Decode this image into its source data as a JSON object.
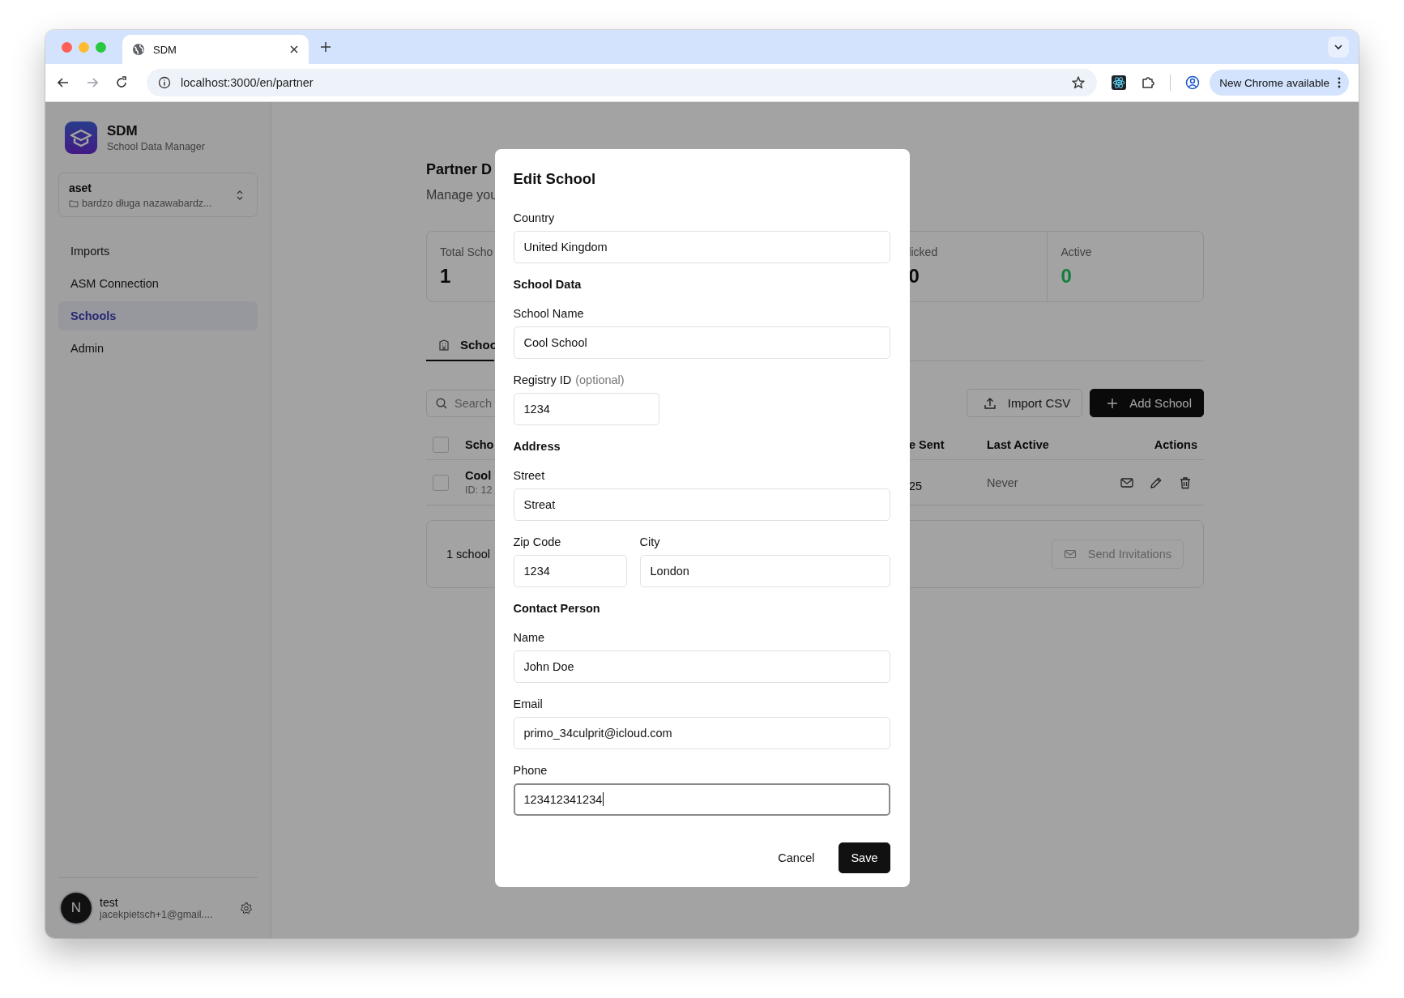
{
  "browser": {
    "tab_title": "SDM",
    "url": "localhost:3000/en/partner",
    "update_button": "New Chrome available"
  },
  "sidebar": {
    "app_name": "SDM",
    "app_subtitle": "School Data Manager",
    "org": {
      "name": "aset",
      "folder": "bardzo długa nazawabardz..."
    },
    "nav": [
      {
        "label": "Imports",
        "selected": false
      },
      {
        "label": "ASM Connection",
        "selected": false
      },
      {
        "label": "Schools",
        "selected": true
      },
      {
        "label": "Admin",
        "selected": false
      }
    ],
    "user": {
      "avatar_initial": "N",
      "name": "test",
      "email": "jacekpietsch+1@gmail...."
    }
  },
  "page": {
    "title": "Partner D",
    "subtitle": "Manage you",
    "stats": [
      {
        "label": "Total Scho",
        "value": "1",
        "highlight": false
      },
      {
        "label": "licked",
        "value": "0",
        "highlight": false
      },
      {
        "label": "Active",
        "value": "0",
        "highlight": true
      }
    ],
    "tabs": [
      {
        "label": "Schoo",
        "selected": true
      }
    ],
    "search": {
      "placeholder": "Search"
    },
    "toolbar_buttons": [
      {
        "label": "Import CSV",
        "kind": "outline"
      },
      {
        "label": "Add School",
        "kind": "primary"
      }
    ],
    "table": {
      "all_checked": false,
      "columns": [
        {
          "label": "Scho"
        },
        {
          "label": "e Sent"
        },
        {
          "label": "Last Active"
        },
        {
          "label": "Actions"
        }
      ],
      "rows": [
        {
          "checked": false,
          "name": "Cool",
          "id": "ID: 12",
          "sent": "25",
          "last_active": "Never"
        }
      ]
    },
    "footer": {
      "text": "1 school",
      "button": "Send Invitations"
    }
  },
  "dialog": {
    "title": "Edit School",
    "items": [
      {
        "kind": "field",
        "label": "Country",
        "value": "United Kingdom",
        "focused": false
      },
      {
        "kind": "heading",
        "text": "School Data"
      },
      {
        "kind": "field",
        "label": "School Name",
        "value": "Cool School",
        "focused": false
      },
      {
        "kind": "short-field",
        "label": "Registry ID",
        "hint": "(optional)",
        "value": "1234",
        "focused": false
      },
      {
        "kind": "heading",
        "text": "Address"
      },
      {
        "kind": "field",
        "label": "Street",
        "value": "Streat",
        "focused": false
      },
      {
        "kind": "pair",
        "fields": [
          {
            "label": "Zip Code",
            "value": "1234",
            "focused": false
          },
          {
            "label": "City",
            "value": "London",
            "focused": false
          }
        ]
      },
      {
        "kind": "heading",
        "text": "Contact Person"
      },
      {
        "kind": "field",
        "label": "Name",
        "value": "John Doe",
        "focused": false
      },
      {
        "kind": "field",
        "label": "Email",
        "value": "primo_34culprit@icloud.com",
        "focused": false
      },
      {
        "kind": "field",
        "label": "Phone",
        "value": "123412341234",
        "focused": true
      }
    ],
    "buttons": [
      {
        "label": "Cancel",
        "kind": "ghost"
      },
      {
        "label": "Save",
        "kind": "primary"
      }
    ]
  }
}
